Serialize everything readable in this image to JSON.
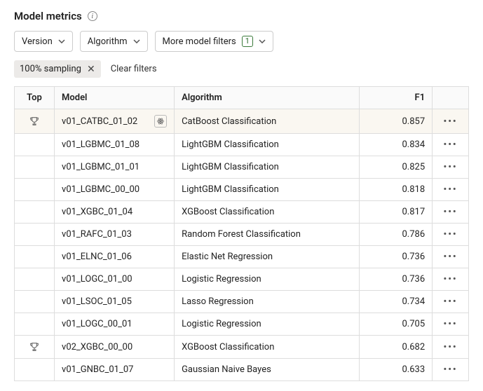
{
  "header": {
    "title": "Model metrics"
  },
  "filters": {
    "version_label": "Version",
    "algorithm_label": "Algorithm",
    "more_label": "More model filters",
    "more_count": "1"
  },
  "chips": {
    "sampling_label": "100% sampling",
    "clear_label": "Clear filters"
  },
  "table": {
    "columns": {
      "top": "Top",
      "model": "Model",
      "algo": "Algorithm",
      "f1": "F1"
    },
    "rows": [
      {
        "top": true,
        "highlight": true,
        "model": "v01_CATBC_01_02",
        "model_icon": true,
        "algo": "CatBoost Classification",
        "f1": "0.857"
      },
      {
        "top": false,
        "highlight": false,
        "model": "v01_LGBMC_01_08",
        "model_icon": false,
        "algo": "LightGBM Classification",
        "f1": "0.834"
      },
      {
        "top": false,
        "highlight": false,
        "model": "v01_LGBMC_01_01",
        "model_icon": false,
        "algo": "LightGBM Classification",
        "f1": "0.825"
      },
      {
        "top": false,
        "highlight": false,
        "model": "v01_LGBMC_00_00",
        "model_icon": false,
        "algo": "LightGBM Classification",
        "f1": "0.818"
      },
      {
        "top": false,
        "highlight": false,
        "model": "v01_XGBC_01_04",
        "model_icon": false,
        "algo": "XGBoost Classification",
        "f1": "0.817"
      },
      {
        "top": false,
        "highlight": false,
        "model": "v01_RAFC_01_03",
        "model_icon": false,
        "algo": "Random Forest Classification",
        "f1": "0.786"
      },
      {
        "top": false,
        "highlight": false,
        "model": "v01_ELNC_01_06",
        "model_icon": false,
        "algo": "Elastic Net Regression",
        "f1": "0.736"
      },
      {
        "top": false,
        "highlight": false,
        "model": "v01_LOGC_01_00",
        "model_icon": false,
        "algo": "Logistic Regression",
        "f1": "0.736"
      },
      {
        "top": false,
        "highlight": false,
        "model": "v01_LSOC_01_05",
        "model_icon": false,
        "algo": "Lasso Regression",
        "f1": "0.734"
      },
      {
        "top": false,
        "highlight": false,
        "model": "v01_LOGC_00_01",
        "model_icon": false,
        "algo": "Logistic Regression",
        "f1": "0.705"
      },
      {
        "top": true,
        "highlight": false,
        "model": "v02_XGBC_00_00",
        "model_icon": false,
        "algo": "XGBoost Classification",
        "f1": "0.682"
      },
      {
        "top": false,
        "highlight": false,
        "model": "v01_GNBC_01_07",
        "model_icon": false,
        "algo": "Gaussian Naive Bayes",
        "f1": "0.633"
      }
    ]
  }
}
